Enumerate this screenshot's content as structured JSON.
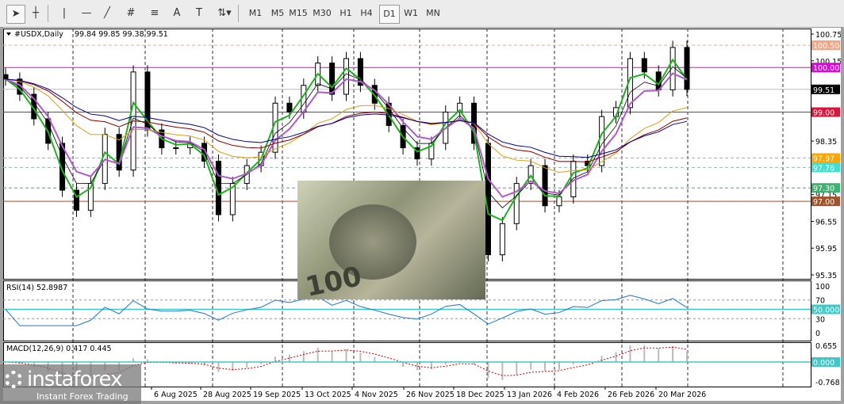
{
  "toolbar": {
    "tools": [
      "cursor-icon",
      "crosshair-icon",
      "vertical-line-icon",
      "horizontal-line-icon",
      "trendline-icon",
      "fibonacci-icon",
      "fibo-grid-icon",
      "text-icon",
      "text-label-icon",
      "arrows-icon"
    ],
    "text_tool": "A",
    "timeframes": [
      "M1",
      "M5",
      "M15",
      "M30",
      "H1",
      "H4",
      "D1",
      "W1",
      "MN"
    ],
    "active_timeframe": "D1"
  },
  "header": {
    "symbol": "#USDX,Daily",
    "ohlc": "99.84 99.85 99.38 99.51"
  },
  "price_axis": {
    "ticks": [
      "100.75",
      "100.15",
      "98.35",
      "97.15",
      "96.55",
      "95.95",
      "95.35"
    ]
  },
  "levels": [
    {
      "value": 100.5,
      "label": "100.50",
      "color": "#f4a582",
      "style": "dashed"
    },
    {
      "value": 100.0,
      "label": "100.00",
      "color": "#e100e1",
      "style": "solid"
    },
    {
      "value": 99.51,
      "label": "99.51",
      "color": "#000000",
      "style": "solid",
      "line": "#bbbbbb"
    },
    {
      "value": 99.0,
      "label": "99.00",
      "color": "#dc143c",
      "style": "solid"
    },
    {
      "value": 97.97,
      "label": "97.97",
      "color": "#ffa500",
      "style": "dashed"
    },
    {
      "value": 97.76,
      "label": "97.76",
      "color": "#40e0d0",
      "style": "dashed"
    },
    {
      "value": 97.3,
      "label": "97.30",
      "color": "#3cb371",
      "style": "dashed"
    },
    {
      "value": 97.0,
      "label": "97.00",
      "color": "#a0522d",
      "style": "solid"
    }
  ],
  "chart_data": {
    "type": "candlestick",
    "title": "#USDX,Daily",
    "ylim": [
      95.35,
      100.75
    ],
    "close": [
      99.74,
      99.4,
      98.85,
      98.3,
      97.25,
      96.8,
      97.4,
      98.5,
      97.7,
      99.9,
      98.6,
      98.2,
      98.2,
      98.3,
      97.9,
      96.7,
      97.4,
      97.8,
      98.1,
      99.2,
      99.0,
      99.6,
      100.1,
      99.4,
      100.2,
      99.6,
      99.2,
      98.7,
      98.2,
      97.95,
      98.3,
      99.0,
      99.2,
      98.3,
      95.8,
      96.5,
      97.4,
      97.8,
      96.9,
      97.1,
      97.9,
      97.8,
      98.9,
      99.1,
      100.2,
      99.9,
      99.5,
      100.45,
      99.51
    ],
    "x_labels": [
      "6 Aug 2025",
      "28 Aug 2025",
      "19 Sep 2025",
      "13 Oct 2025",
      "4 Nov 2025",
      "26 Nov 2025",
      "18 Dec 2025",
      "13 Jan 2026",
      "4 Feb 2026",
      "26 Feb 2026",
      "20 Mar 2026"
    ],
    "grid": true
  },
  "rsi": {
    "label": "RSI(14) 52.8987",
    "ticks": [
      "100",
      "70",
      "30",
      "0"
    ],
    "level_label": "50.0000"
  },
  "macd": {
    "label": "MACD(12,26,9) 0.417 0.445",
    "ticks": [
      "0.655",
      "-0.768"
    ],
    "zero_label": "0.000"
  },
  "photo": {
    "text": "100"
  },
  "logo": {
    "name": "instaforex",
    "tagline": "Instant Forex Trading"
  }
}
